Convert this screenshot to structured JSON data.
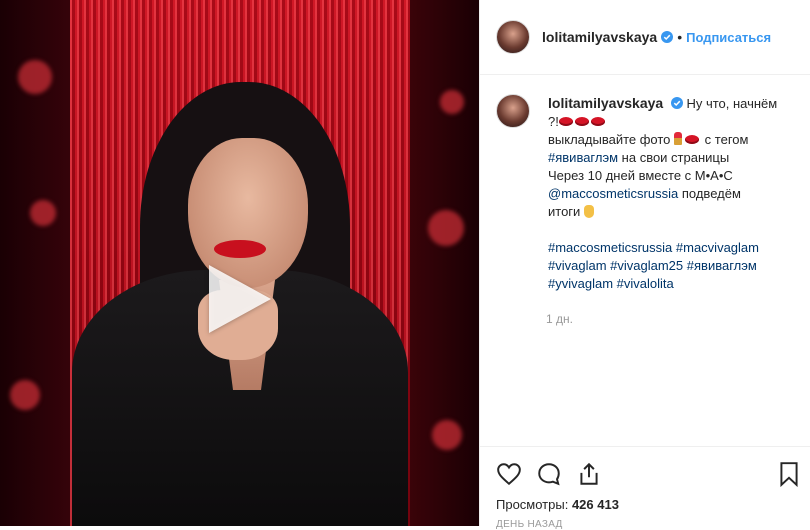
{
  "post": {
    "author": "lolitamilyavskaya",
    "follow_label": "Подписаться",
    "separator": "•",
    "caption": {
      "line1": "Ну что, начнём",
      "line2_prefix": "?!",
      "line3": "выкладывайте фото",
      "line3_suffix": "с тегом",
      "hashtag_inline": "#явиваглэм",
      "line4_suffix": "на свои страницы",
      "line5": "Через 10 дней вместе с M•A•C",
      "mention": "@maccosmeticsrussia",
      "mention_suffix": "подведём",
      "line7": "итоги"
    },
    "hashtags": [
      "#maccosmeticsrussia",
      "#macvivaglam",
      "#vivaglam",
      "#vivaglam25",
      "#явиваглэм",
      "#yvivaglam",
      "#vivalolita"
    ],
    "time_ago": "1 дн.",
    "views_label": "Просмотры:",
    "views_count": "426 413",
    "date_label": "День назад"
  },
  "icons": {
    "like": "heart-icon",
    "comment": "comment-icon",
    "share": "share-icon",
    "save": "bookmark-icon",
    "verified": "verified-badge-icon",
    "play": "play-icon"
  },
  "colors": {
    "link": "#003569",
    "follow": "#3897f0",
    "verified": "#3897f0",
    "muted": "#999999"
  }
}
